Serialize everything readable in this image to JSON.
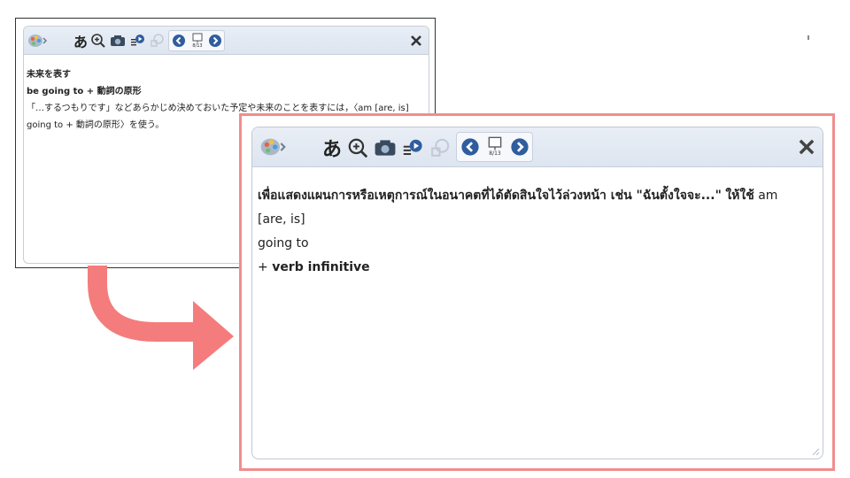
{
  "toolbar": {
    "icons": [
      "palette-icon",
      "japanese-char-icon",
      "zoom-in-icon",
      "camera-icon",
      "audio-play-icon",
      "copy-icon",
      "prev-page-icon",
      "page-indicator-icon",
      "next-page-icon",
      "close-icon"
    ],
    "japanese_char": "あ",
    "page_indicator": "8/13"
  },
  "original": {
    "title_line": "未来を表す",
    "grammar_line": "be going to + 動詞の原形",
    "desc_line1": "「…するつもりです」などあらかじめ決めておいた予定や未来のことを表すには，〈am [are, is]",
    "desc_line2": "going to + 動詞の原形〉を使う。"
  },
  "translated": {
    "thai_text": "เพื่อแสดงแผนการหรือเหตุการณ์ในอนาคตที่ได้ตัดสินใจไว้ล่วงหน้า เช่น \"ฉันตั้งใจจะ...\"",
    "use_word": "ให้ใช้",
    "am_text": "am [are, is]",
    "going_to": "going to",
    "plus_sign": "+",
    "verb_infinitive": "verb infinitive"
  },
  "colors": {
    "highlight_border": "#f28d8d",
    "toolbar_bg": "#e2e9f3",
    "nav_button": "#2f5d9e",
    "arrow": "#f47c7c"
  }
}
